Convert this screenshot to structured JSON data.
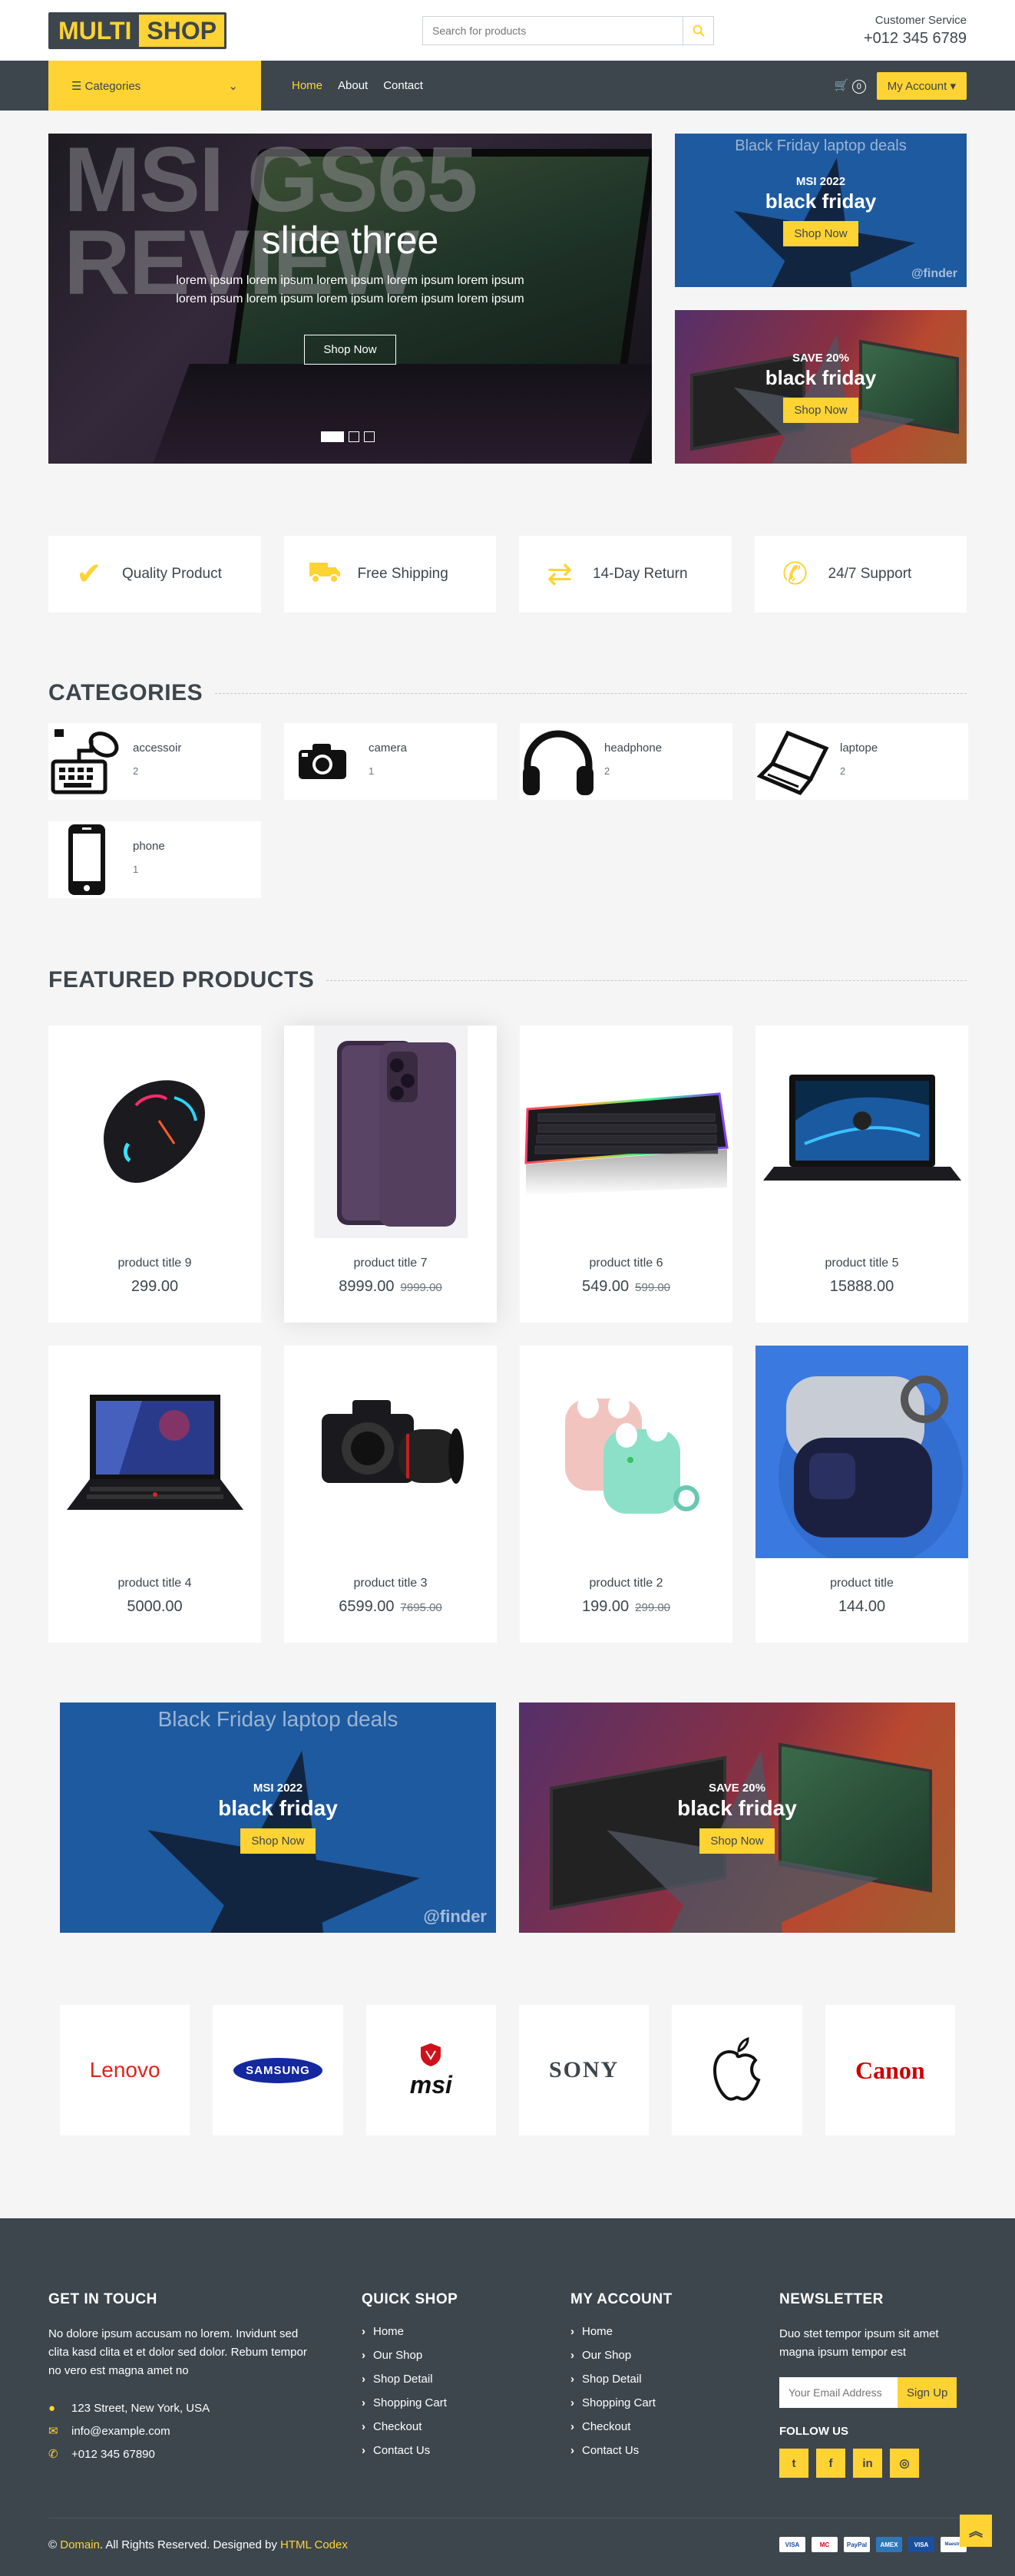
{
  "header": {
    "logo_part1": "MULTI",
    "logo_part2": "SHOP",
    "search_placeholder": "Search for products",
    "service_label": "Customer Service",
    "service_phone": "+012 345 6789"
  },
  "nav": {
    "categories_label": "Categories",
    "menu": [
      "Home",
      "About",
      "Contact"
    ],
    "cart_count": "0",
    "account_label": "My Account"
  },
  "carousel": {
    "bg_text_line1": "MSI GS65",
    "bg_text_line2": "REVIEW",
    "title": "slide three",
    "text": "lorem ipsum lorem ipsum lorem ipsum lorem ipsum lorem ipsum lorem ipsum lorem ipsum lorem ipsum lorem ipsum lorem ipsum",
    "button": "Shop Now"
  },
  "promos": [
    {
      "bg_text": "Black Friday laptop deals",
      "small": "MSI 2022",
      "large": "black friday",
      "button": "Shop Now",
      "brand": "finder"
    },
    {
      "small": "SAVE 20%",
      "large": "black friday",
      "button": "Shop Now"
    }
  ],
  "features": [
    {
      "icon": "check-icon",
      "label": "Quality Product"
    },
    {
      "icon": "truck-icon",
      "label": "Free Shipping"
    },
    {
      "icon": "exchange-icon",
      "label": "14-Day Return"
    },
    {
      "icon": "phone-volume-icon",
      "label": "24/7 Support"
    }
  ],
  "categories": {
    "title": "CATEGORIES",
    "items": [
      {
        "name": "accessoir",
        "count": "2"
      },
      {
        "name": "camera",
        "count": "1"
      },
      {
        "name": "headphone",
        "count": "2"
      },
      {
        "name": "laptope",
        "count": "2"
      },
      {
        "name": "phone",
        "count": "1"
      }
    ]
  },
  "featured": {
    "title": "FEATURED PRODUCTS",
    "products": [
      {
        "title": "product title 9",
        "price": "299.00",
        "old_price": ""
      },
      {
        "title": "product title 7",
        "price": "8999.00",
        "old_price": "9999.00"
      },
      {
        "title": "product title 6",
        "price": "549.00",
        "old_price": "599.00"
      },
      {
        "title": "product title 5",
        "price": "15888.00",
        "old_price": ""
      },
      {
        "title": "product title 4",
        "price": "5000.00",
        "old_price": ""
      },
      {
        "title": "product title 3",
        "price": "6599.00",
        "old_price": "7695.00"
      },
      {
        "title": "product title 2",
        "price": "199.00",
        "old_price": "299.00"
      },
      {
        "title": "product title",
        "price": "144.00",
        "old_price": ""
      }
    ]
  },
  "vendors": [
    "Lenovo",
    "SAMSUNG",
    "msi",
    "SONY",
    "Apple",
    "Canon"
  ],
  "footer": {
    "touch_title": "GET IN TOUCH",
    "touch_text": "No dolore ipsum accusam no lorem. Invidunt sed clita kasd clita et et dolor sed dolor. Rebum tempor no vero est magna amet no",
    "address": "123 Street, New York, USA",
    "email": "info@example.com",
    "phone": "+012 345 67890",
    "quick_title": "QUICK SHOP",
    "quick_links": [
      "Home",
      "Our Shop",
      "Shop Detail",
      "Shopping Cart",
      "Checkout",
      "Contact Us"
    ],
    "account_title": "MY ACCOUNT",
    "account_links": [
      "Home",
      "Our Shop",
      "Shop Detail",
      "Shopping Cart",
      "Checkout",
      "Contact Us"
    ],
    "news_title": "NEWSLETTER",
    "news_text": "Duo stet tempor ipsum sit amet magna ipsum tempor est",
    "news_placeholder": "Your Email Address",
    "news_button": "Sign Up",
    "follow_title": "FOLLOW US",
    "copyright_prefix": "©",
    "copyright_domain": "Domain",
    "copyright_mid": ". All Rights Reserved. Designed by",
    "copyright_designer": "HTML Codex",
    "payments": [
      "VISA",
      "MC",
      "PayPal",
      "AMEX",
      "VISA",
      "Maestro"
    ]
  },
  "colors": {
    "accent": "#ffd333",
    "dark": "#3d464d",
    "bg": "#f5f5f5"
  }
}
